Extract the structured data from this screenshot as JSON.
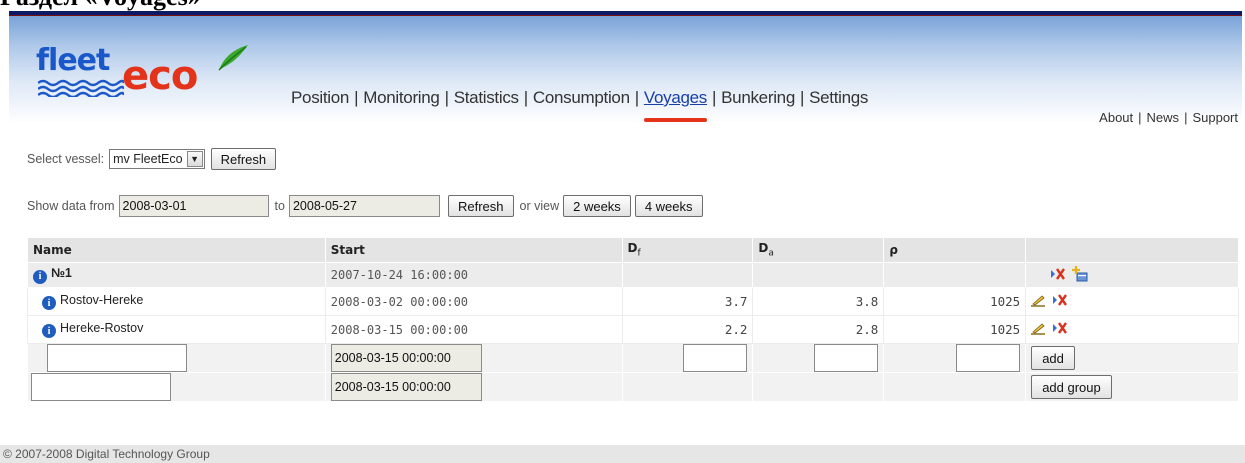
{
  "doc_heading": "Раздел «Voyages»",
  "logo": {
    "word1": "fleet",
    "word2": "eco"
  },
  "main_nav": {
    "items": [
      "Position",
      "Monitoring",
      "Statistics",
      "Consumption",
      "Voyages",
      "Bunkering",
      "Settings"
    ],
    "active": "Voyages",
    "separator": "|"
  },
  "aux_nav": {
    "items": [
      "About",
      "News",
      "Support"
    ],
    "separator": "|"
  },
  "vessel_selector": {
    "label": "Select vessel:",
    "selected": "mv FleetEco",
    "refresh_label": "Refresh"
  },
  "date_filter": {
    "from_label": "Show data from",
    "from_value": "2008-03-01",
    "to_label": "to",
    "to_value": "2008-05-27",
    "refresh_label": "Refresh",
    "or_view_label": "or view",
    "two_weeks_label": "2 weeks",
    "four_weeks_label": "4 weeks"
  },
  "table": {
    "headers": {
      "name": "Name",
      "start": "Start",
      "df": "D",
      "df_sub": "f",
      "da": "D",
      "da_sub": "a",
      "rho": "ρ",
      "actions": ""
    },
    "group": {
      "name": "№1",
      "start": "2007-10-24 16:00:00"
    },
    "voyages": [
      {
        "name": "Rostov-Hereke",
        "start": "2008-03-02 00:00:00",
        "df": "3.7",
        "da": "3.8",
        "rho": "1025"
      },
      {
        "name": "Hereke-Rostov",
        "start": "2008-03-15 00:00:00",
        "df": "2.2",
        "da": "2.8",
        "rho": "1025"
      }
    ],
    "new_voyage": {
      "start": "2008-03-15 00:00:00",
      "add_label": "add"
    },
    "new_group": {
      "start": "2008-03-15 00:00:00",
      "add_label": "add group"
    }
  },
  "footer": {
    "copyright": "© 2007-2008 Digital Technology Group"
  },
  "colors": {
    "brand_blue": "#1a57c8",
    "brand_red": "#e3331b",
    "active_nav": "#1a3ea8",
    "header_top": "#0c1a66"
  },
  "icons": [
    "info-icon",
    "delete-icon",
    "add-voyage-icon",
    "edit-icon",
    "select-arrow-icon",
    "leaf-icon",
    "waves-icon"
  ]
}
